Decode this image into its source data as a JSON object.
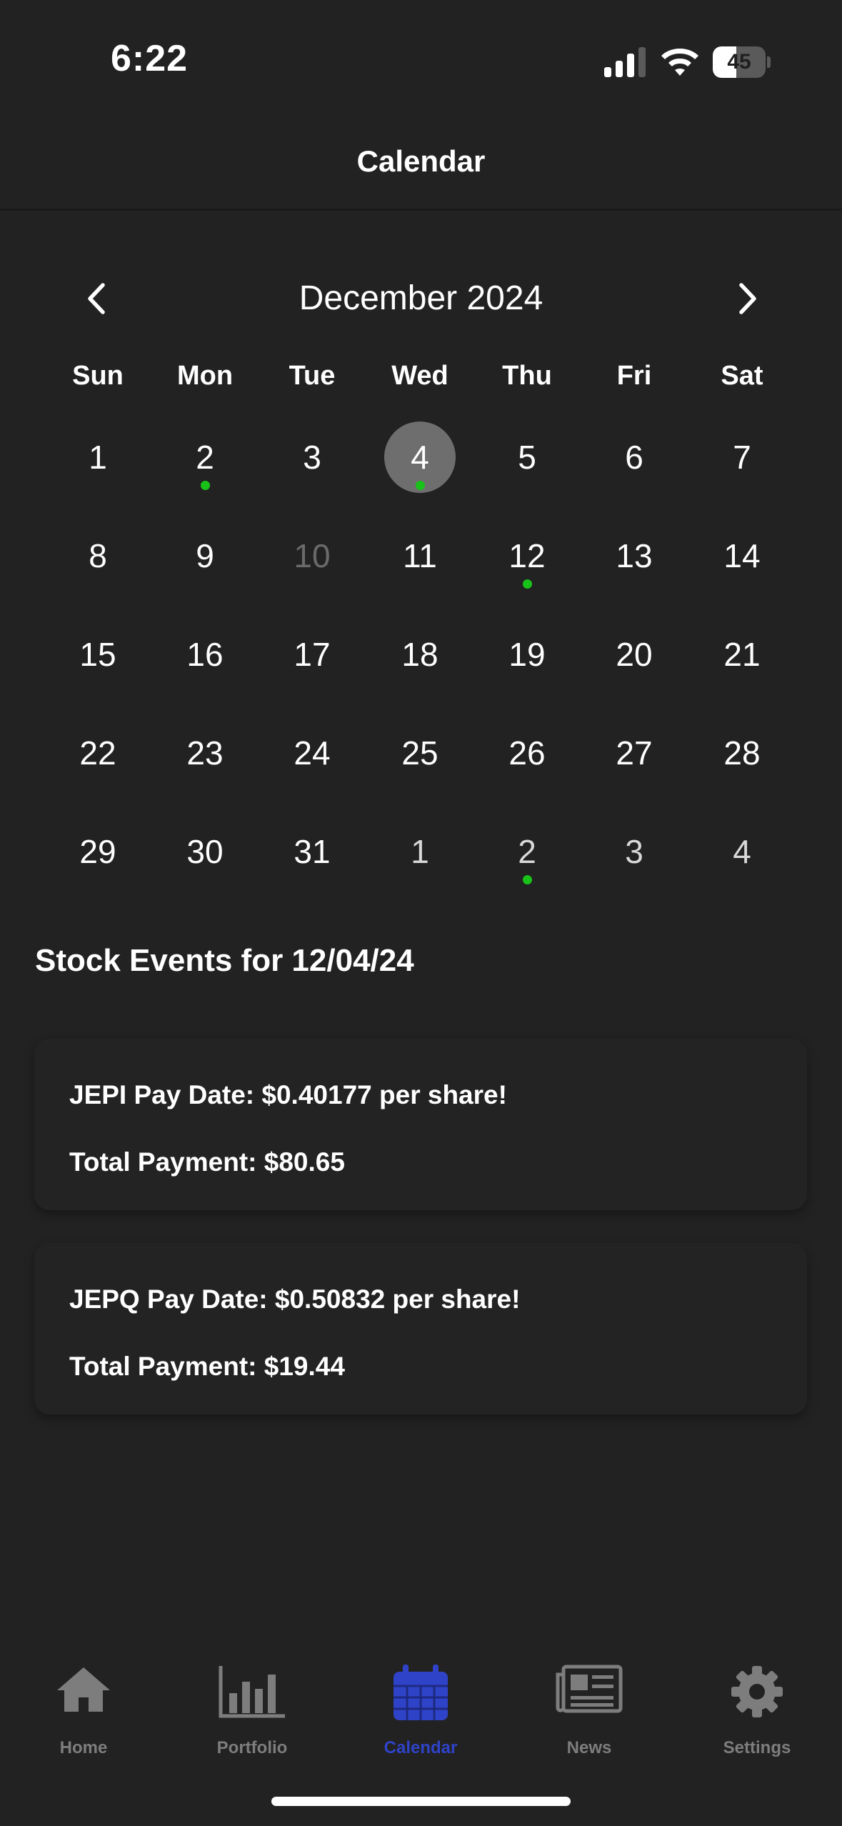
{
  "status_bar": {
    "time": "6:22",
    "battery_percent": "45",
    "battery_level": 0.45
  },
  "nav": {
    "title": "Calendar"
  },
  "calendar": {
    "month_label": "December 2024",
    "weekdays": [
      "Sun",
      "Mon",
      "Tue",
      "Wed",
      "Thu",
      "Fri",
      "Sat"
    ],
    "weeks": [
      [
        {
          "d": "1"
        },
        {
          "d": "2",
          "dot": true
        },
        {
          "d": "3"
        },
        {
          "d": "4",
          "selected": true,
          "dot": true
        },
        {
          "d": "5"
        },
        {
          "d": "6"
        },
        {
          "d": "7"
        }
      ],
      [
        {
          "d": "8"
        },
        {
          "d": "9"
        },
        {
          "d": "10",
          "disabled": true
        },
        {
          "d": "11"
        },
        {
          "d": "12",
          "dot": true
        },
        {
          "d": "13"
        },
        {
          "d": "14"
        }
      ],
      [
        {
          "d": "15"
        },
        {
          "d": "16"
        },
        {
          "d": "17"
        },
        {
          "d": "18"
        },
        {
          "d": "19"
        },
        {
          "d": "20"
        },
        {
          "d": "21"
        }
      ],
      [
        {
          "d": "22"
        },
        {
          "d": "23"
        },
        {
          "d": "24"
        },
        {
          "d": "25"
        },
        {
          "d": "26"
        },
        {
          "d": "27"
        },
        {
          "d": "28"
        }
      ],
      [
        {
          "d": "29"
        },
        {
          "d": "30"
        },
        {
          "d": "31"
        },
        {
          "d": "1",
          "next": true
        },
        {
          "d": "2",
          "next": true,
          "dot": true
        },
        {
          "d": "3",
          "next": true
        },
        {
          "d": "4",
          "next": true
        }
      ]
    ]
  },
  "events": {
    "section_title": "Stock Events for 12/04/24",
    "items": [
      {
        "line1": "JEPI Pay Date: $0.40177 per share!",
        "line2": "Total Payment: $80.65"
      },
      {
        "line1": "JEPQ Pay Date: $0.50832 per share!",
        "line2": "Total Payment: $19.44"
      }
    ]
  },
  "tabs": [
    {
      "label": "Home",
      "icon": "home-icon"
    },
    {
      "label": "Portfolio",
      "icon": "bar-chart-icon"
    },
    {
      "label": "Calendar",
      "icon": "calendar-icon",
      "active": true
    },
    {
      "label": "News",
      "icon": "newspaper-icon"
    },
    {
      "label": "Settings",
      "icon": "gear-icon"
    }
  ],
  "colors": {
    "background": "#222222",
    "accent": "#2f43c9",
    "event_dot": "#19c219",
    "inactive_tab": "#7d7d7d",
    "selected_day": "#6e6e6e"
  }
}
